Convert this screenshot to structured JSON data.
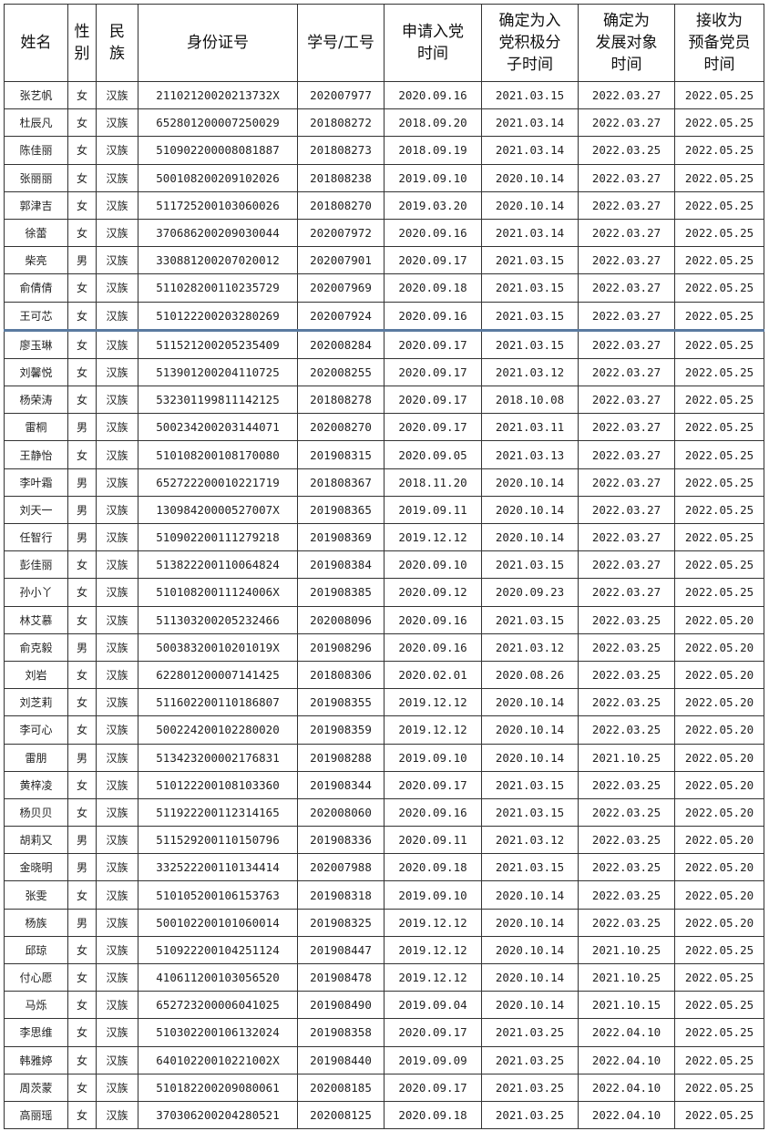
{
  "columns": [
    {
      "key": "name",
      "label": "姓名"
    },
    {
      "key": "gender",
      "label": "性\n别"
    },
    {
      "key": "ethnicity",
      "label": "民\n族"
    },
    {
      "key": "id_number",
      "label": "身份证号"
    },
    {
      "key": "student_id",
      "label": "学号/工号"
    },
    {
      "key": "apply_date",
      "label": "申请入党\n时间"
    },
    {
      "key": "activist_date",
      "label": "确定为入\n党积极分\n子时间"
    },
    {
      "key": "development_date",
      "label": "确定为\n发展对象\n时间"
    },
    {
      "key": "probationary_date",
      "label": "接收为\n预备党员\n时间"
    }
  ],
  "rows": [
    [
      "张艺帆",
      "女",
      "汉族",
      "21102120020213732X",
      "202007977",
      "2020.09.16",
      "2021.03.15",
      "2022.03.27",
      "2022.05.25"
    ],
    [
      "杜辰凡",
      "女",
      "汉族",
      "652801200007250029",
      "201808272",
      "2018.09.20",
      "2021.03.14",
      "2022.03.27",
      "2022.05.25"
    ],
    [
      "陈佳丽",
      "女",
      "汉族",
      "510902200008081887",
      "201808273",
      "2018.09.19",
      "2021.03.14",
      "2022.03.25",
      "2022.05.25"
    ],
    [
      "张丽丽",
      "女",
      "汉族",
      "500108200209102026",
      "201808238",
      "2019.09.10",
      "2020.10.14",
      "2022.03.27",
      "2022.05.25"
    ],
    [
      "郭津吉",
      "女",
      "汉族",
      "511725200103060026",
      "201808270",
      "2019.03.20",
      "2020.10.14",
      "2022.03.27",
      "2022.05.25"
    ],
    [
      "徐蕾",
      "女",
      "汉族",
      "370686200209030044",
      "202007972",
      "2020.09.16",
      "2021.03.14",
      "2022.03.27",
      "2022.05.25"
    ],
    [
      "柴亮",
      "男",
      "汉族",
      "330881200207020012",
      "202007901",
      "2020.09.17",
      "2021.03.15",
      "2022.03.27",
      "2022.05.25"
    ],
    [
      "俞倩倩",
      "女",
      "汉族",
      "511028200110235729",
      "202007969",
      "2020.09.18",
      "2021.03.15",
      "2022.03.27",
      "2022.05.25"
    ],
    [
      "王可芯",
      "女",
      "汉族",
      "510122200203280269",
      "202007924",
      "2020.09.16",
      "2021.03.15",
      "2022.03.27",
      "2022.05.25"
    ],
    [
      "廖玉琳",
      "女",
      "汉族",
      "511521200205235409",
      "202008284",
      "2020.09.17",
      "2021.03.15",
      "2022.03.27",
      "2022.05.25"
    ],
    [
      "刘馨悦",
      "女",
      "汉族",
      "513901200204110725",
      "202008255",
      "2020.09.17",
      "2021.03.12",
      "2022.03.27",
      "2022.05.25"
    ],
    [
      "杨荣涛",
      "女",
      "汉族",
      "532301199811142125",
      "201808278",
      "2020.09.17",
      "2018.10.08",
      "2022.03.27",
      "2022.05.25"
    ],
    [
      "雷桐",
      "男",
      "汉族",
      "500234200203144071",
      "202008270",
      "2020.09.17",
      "2021.03.11",
      "2022.03.27",
      "2022.05.25"
    ],
    [
      "王静怡",
      "女",
      "汉族",
      "510108200108170080",
      "201908315",
      "2020.09.05",
      "2021.03.13",
      "2022.03.27",
      "2022.05.25"
    ],
    [
      "李叶霜",
      "男",
      "汉族",
      "652722200010221719",
      "201808367",
      "2018.11.20",
      "2020.10.14",
      "2022.03.27",
      "2022.05.25"
    ],
    [
      "刘天一",
      "男",
      "汉族",
      "13098420000527007X",
      "201908365",
      "2019.09.11",
      "2020.10.14",
      "2022.03.27",
      "2022.05.25"
    ],
    [
      "任智行",
      "男",
      "汉族",
      "510902200111279218",
      "201908369",
      "2019.12.12",
      "2020.10.14",
      "2022.03.27",
      "2022.05.25"
    ],
    [
      "彭佳丽",
      "女",
      "汉族",
      "513822200110064824",
      "201908384",
      "2020.09.10",
      "2021.03.15",
      "2022.03.27",
      "2022.05.25"
    ],
    [
      "孙小丫",
      "女",
      "汉族",
      "51010820011124006X",
      "201908385",
      "2020.09.12",
      "2020.09.23",
      "2022.03.27",
      "2022.05.25"
    ],
    [
      "林艾慕",
      "女",
      "汉族",
      "511303200205232466",
      "202008096",
      "2020.09.16",
      "2021.03.15",
      "2022.03.25",
      "2022.05.20"
    ],
    [
      "俞克毅",
      "男",
      "汉族",
      "50038320010201019X",
      "201908296",
      "2020.09.16",
      "2021.03.12",
      "2022.03.25",
      "2022.05.20"
    ],
    [
      "刘岩",
      "女",
      "汉族",
      "622801200007141425",
      "201808306",
      "2020.02.01",
      "2020.08.26",
      "2022.03.25",
      "2022.05.20"
    ],
    [
      "刘芝莉",
      "女",
      "汉族",
      "511602200110186807",
      "201908355",
      "2019.12.12",
      "2020.10.14",
      "2022.03.25",
      "2022.05.20"
    ],
    [
      "李可心",
      "女",
      "汉族",
      "500224200102280020",
      "201908359",
      "2019.12.12",
      "2020.10.14",
      "2022.03.25",
      "2022.05.20"
    ],
    [
      "雷朋",
      "男",
      "汉族",
      "513423200002176831",
      "201908288",
      "2019.09.10",
      "2020.10.14",
      "2021.10.25",
      "2022.05.20"
    ],
    [
      "黄梓凌",
      "女",
      "汉族",
      "510122200108103360",
      "201908344",
      "2020.09.17",
      "2021.03.15",
      "2022.03.25",
      "2022.05.20"
    ],
    [
      "杨贝贝",
      "女",
      "汉族",
      "511922200112314165",
      "202008060",
      "2020.09.16",
      "2021.03.15",
      "2022.03.25",
      "2022.05.20"
    ],
    [
      "胡莉又",
      "男",
      "汉族",
      "511529200110150796",
      "201908336",
      "2020.09.11",
      "2021.03.12",
      "2022.03.25",
      "2022.05.20"
    ],
    [
      "金晓明",
      "男",
      "汉族",
      "332522200110134414",
      "202007988",
      "2020.09.18",
      "2021.03.15",
      "2022.03.25",
      "2022.05.20"
    ],
    [
      "张雯",
      "女",
      "汉族",
      "510105200106153763",
      "201908318",
      "2019.09.10",
      "2020.10.14",
      "2022.03.25",
      "2022.05.20"
    ],
    [
      "杨族",
      "男",
      "汉族",
      "500102200101060014",
      "201908325",
      "2019.12.12",
      "2020.10.14",
      "2022.03.25",
      "2022.05.20"
    ],
    [
      "邱琼",
      "女",
      "汉族",
      "510922200104251124",
      "201908447",
      "2019.12.12",
      "2020.10.14",
      "2021.10.25",
      "2022.05.25"
    ],
    [
      "付心愿",
      "女",
      "汉族",
      "410611200103056520",
      "201908478",
      "2019.12.12",
      "2020.10.14",
      "2021.10.25",
      "2022.05.25"
    ],
    [
      "马烁",
      "女",
      "汉族",
      "652723200006041025",
      "201908490",
      "2019.09.04",
      "2020.10.14",
      "2021.10.15",
      "2022.05.25"
    ],
    [
      "李思维",
      "女",
      "汉族",
      "510302200106132024",
      "201908358",
      "2020.09.17",
      "2021.03.25",
      "2022.04.10",
      "2022.05.25"
    ],
    [
      "韩雅婷",
      "女",
      "汉族",
      "64010220010221002X",
      "201908440",
      "2019.09.09",
      "2021.03.25",
      "2022.04.10",
      "2022.05.25"
    ],
    [
      "周茨蒙",
      "女",
      "汉族",
      "510182200209080061",
      "202008185",
      "2020.09.17",
      "2021.03.25",
      "2022.04.10",
      "2022.05.25"
    ],
    [
      "高丽瑶",
      "女",
      "汉族",
      "370306200204280521",
      "202008125",
      "2020.09.18",
      "2021.03.25",
      "2022.04.10",
      "2022.05.25"
    ]
  ]
}
